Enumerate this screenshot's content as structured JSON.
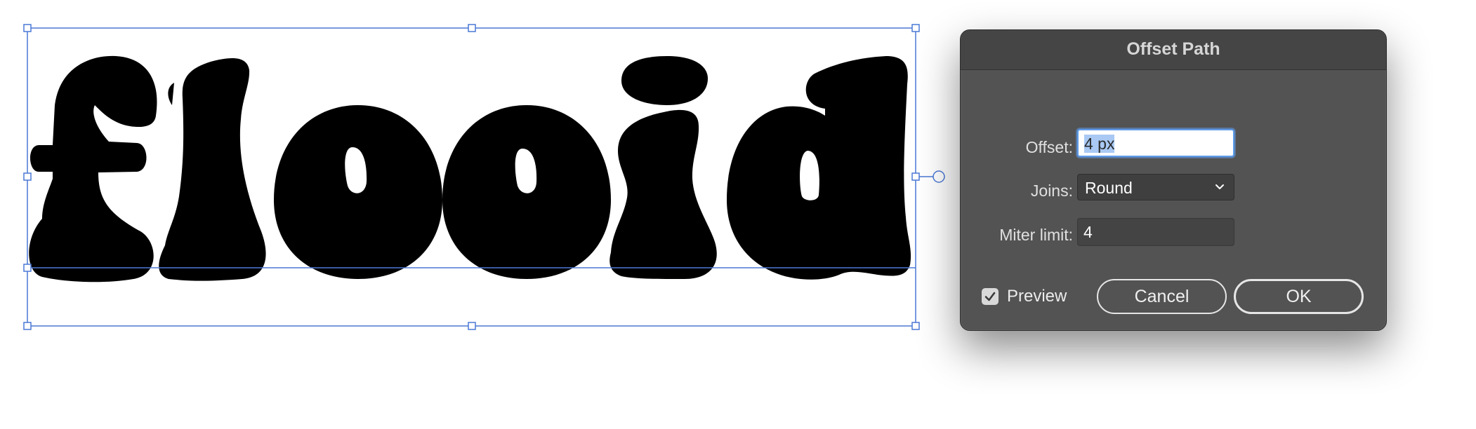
{
  "artwork": {
    "text": "flooid",
    "fill_color": "#000000",
    "selection_color": "#4a78d6"
  },
  "dialog": {
    "title": "Offset Path",
    "offset": {
      "label": "Offset:",
      "value": "4 px"
    },
    "joins": {
      "label": "Joins:",
      "value": "Round",
      "icon": "chevron-down-icon"
    },
    "miter_limit": {
      "label": "Miter limit:",
      "value": "4"
    },
    "preview": {
      "label": "Preview",
      "checked": true,
      "icon": "checkmark-icon"
    },
    "buttons": {
      "cancel": "Cancel",
      "ok": "OK"
    },
    "colors": {
      "background": "#535353",
      "titlebar": "#454545",
      "focus_ring": "#5e9bea"
    }
  }
}
